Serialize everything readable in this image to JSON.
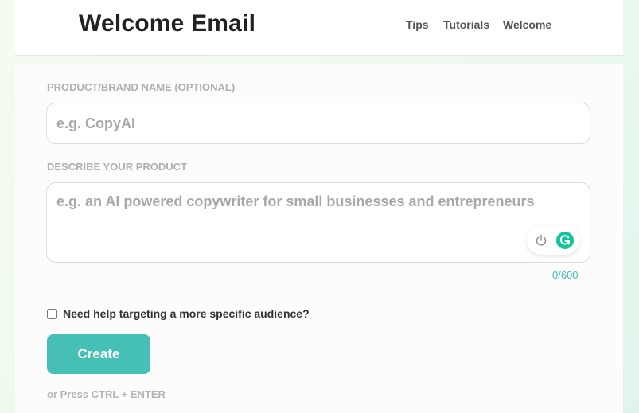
{
  "header": {
    "title": "Welcome Email",
    "nav": [
      "Tips",
      "Tutorials",
      "Welcome"
    ]
  },
  "form": {
    "product_name": {
      "label": "PRODUCT/BRAND NAME (OPTIONAL)",
      "placeholder": "e.g. CopyAI",
      "value": ""
    },
    "description": {
      "label": "DESCRIBE YOUR PRODUCT",
      "placeholder": "e.g. an AI powered copywriter for small businesses and entrepreneurs",
      "value": "",
      "counter": "0/600"
    },
    "audience_checkbox": {
      "label": "Need help targeting a more specific audience?",
      "checked": false
    },
    "create_button": "Create",
    "shortcut_hint": "or Press CTRL + ENTER"
  },
  "grammarly_widget": {
    "icons": [
      "power-icon",
      "grammarly-icon"
    ],
    "brand_color": "#15c39a"
  },
  "colors": {
    "accent": "#46c0b4",
    "counter": "#3fbeb4"
  }
}
